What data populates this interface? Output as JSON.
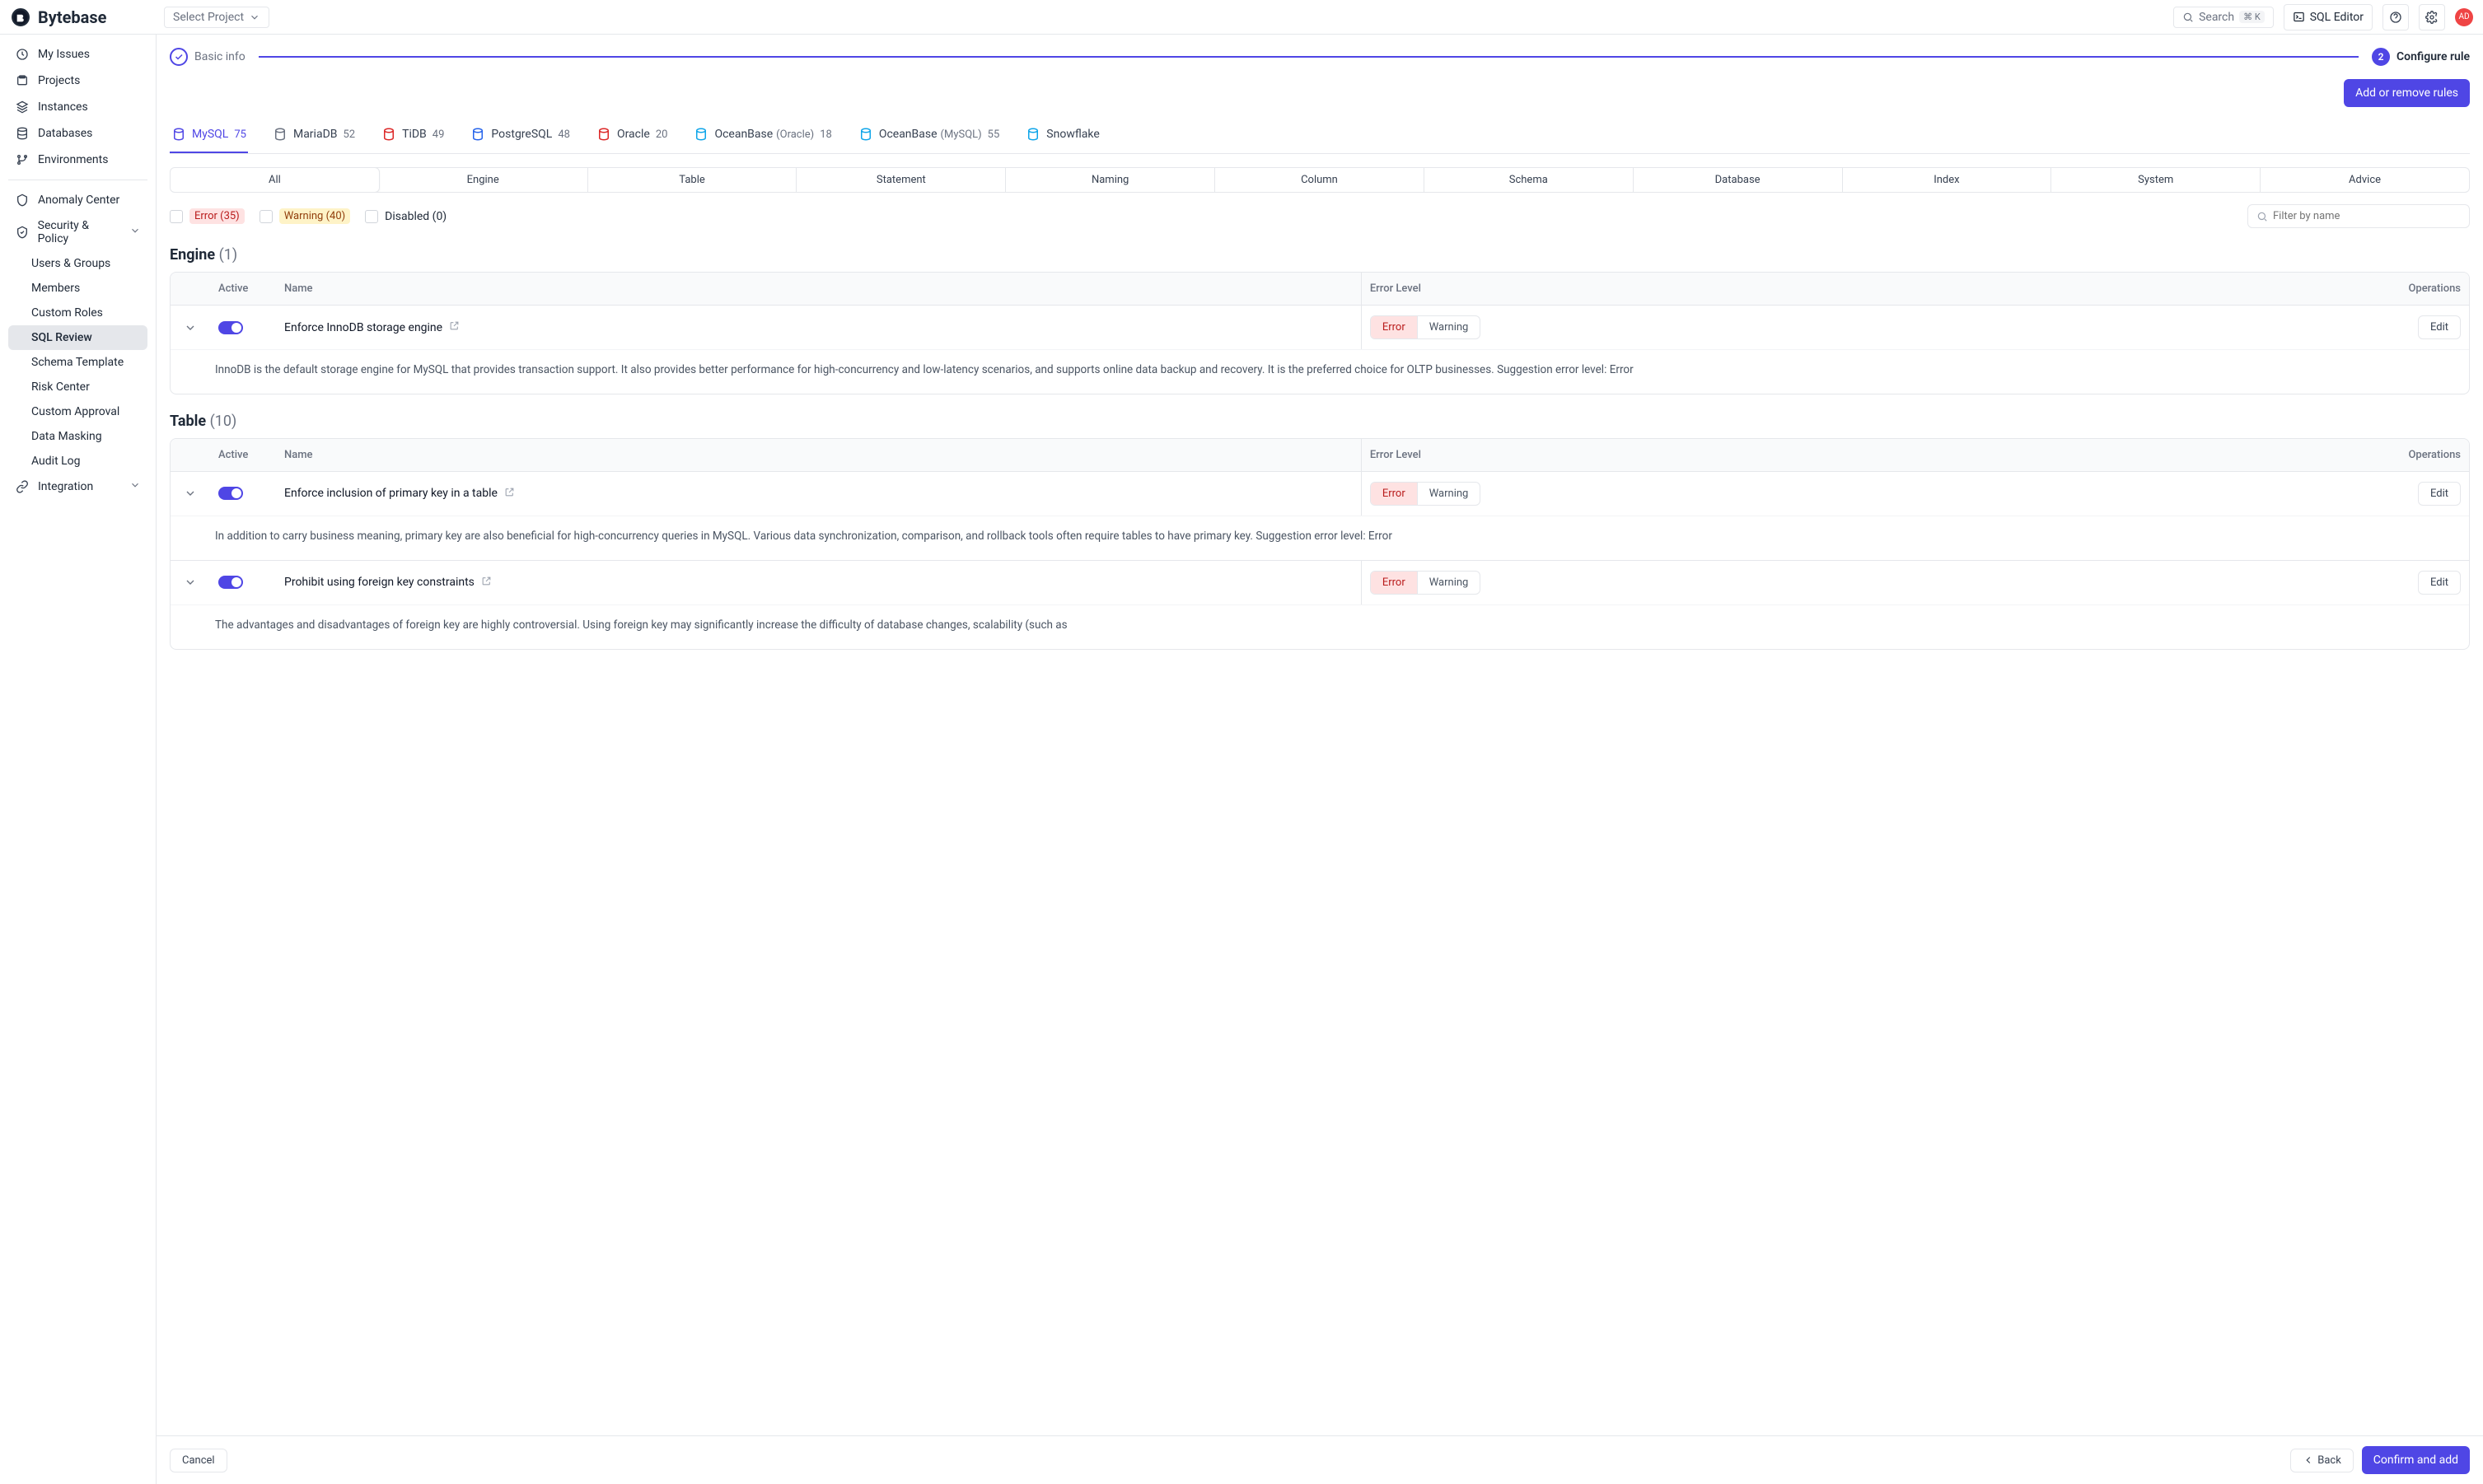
{
  "brand": "Bytebase",
  "header": {
    "select_project": "Select Project",
    "search_placeholder": "Search",
    "search_kbd": "⌘ K",
    "sql_editor": "SQL Editor",
    "avatar": "AD"
  },
  "sidebar": {
    "items": [
      {
        "label": "My Issues",
        "icon": "inbox",
        "sub": false
      },
      {
        "label": "Projects",
        "icon": "folder",
        "sub": false
      },
      {
        "label": "Instances",
        "icon": "stack",
        "sub": false
      },
      {
        "label": "Databases",
        "icon": "database",
        "sub": false
      },
      {
        "label": "Environments",
        "icon": "branch",
        "sub": false
      }
    ],
    "items2": [
      {
        "label": "Anomaly Center",
        "icon": "shield",
        "sub": false,
        "chev": false
      },
      {
        "label": "Security & Policy",
        "icon": "lock",
        "sub": false,
        "chev": true
      },
      {
        "label": "Users & Groups",
        "icon": "",
        "sub": true,
        "chev": false
      },
      {
        "label": "Members",
        "icon": "",
        "sub": true,
        "chev": false
      },
      {
        "label": "Custom Roles",
        "icon": "",
        "sub": true,
        "chev": false
      },
      {
        "label": "SQL Review",
        "icon": "",
        "sub": true,
        "chev": false,
        "active": true
      },
      {
        "label": "Schema Template",
        "icon": "",
        "sub": true,
        "chev": false
      },
      {
        "label": "Risk Center",
        "icon": "",
        "sub": true,
        "chev": false
      },
      {
        "label": "Custom Approval",
        "icon": "",
        "sub": true,
        "chev": false
      },
      {
        "label": "Data Masking",
        "icon": "",
        "sub": true,
        "chev": false
      },
      {
        "label": "Audit Log",
        "icon": "",
        "sub": true,
        "chev": false
      },
      {
        "label": "Integration",
        "icon": "link",
        "sub": false,
        "chev": true
      }
    ]
  },
  "steps": {
    "one_label": "Basic info",
    "two_label": "Configure rule",
    "two_num": "2"
  },
  "actions": {
    "add_remove": "Add or remove rules"
  },
  "db_tabs": [
    {
      "label": "MySQL",
      "count": "75",
      "active": true,
      "color": "#4f46e5"
    },
    {
      "label": "MariaDB",
      "count": "52",
      "color": "#6b7280"
    },
    {
      "label": "TiDB",
      "count": "49",
      "color": "#dc2626"
    },
    {
      "label": "PostgreSQL",
      "count": "48",
      "color": "#2563eb"
    },
    {
      "label": "Oracle",
      "count": "20",
      "color": "#dc2626"
    },
    {
      "label": "OceanBase",
      "sub": "(Oracle)",
      "count": "18",
      "color": "#0ea5e9"
    },
    {
      "label": "OceanBase",
      "sub": "(MySQL)",
      "count": "55",
      "color": "#0ea5e9"
    },
    {
      "label": "Snowflake",
      "count": "",
      "color": "#0ea5e9",
      "cut": true
    }
  ],
  "cat_tabs": [
    "All",
    "Engine",
    "Table",
    "Statement",
    "Naming",
    "Column",
    "Schema",
    "Database",
    "Index",
    "System",
    "Advice"
  ],
  "cat_active": 0,
  "filters": {
    "error": "Error (35)",
    "warning": "Warning (40)",
    "disabled": "Disabled (0)",
    "filter_placeholder": "Filter by name"
  },
  "headers": {
    "active": "Active",
    "name": "Name",
    "error_level": "Error Level",
    "operations": "Operations"
  },
  "levels": {
    "error": "Error",
    "warning": "Warning"
  },
  "edit": "Edit",
  "sections": [
    {
      "title": "Engine",
      "count": "(1)",
      "rules": [
        {
          "name": "Enforce InnoDB storage engine",
          "desc": "InnoDB is the default storage engine for MySQL that provides transaction support. It also provides better performance for high-concurrency and low-latency scenarios, and supports online data backup and recovery. It is the preferred choice for OLTP businesses. Suggestion error level: Error"
        }
      ]
    },
    {
      "title": "Table",
      "count": "(10)",
      "rules": [
        {
          "name": "Enforce inclusion of primary key in a table",
          "desc": "In addition to carry business meaning, primary key are also beneficial for high-concurrency queries in MySQL. Various data synchronization, comparison, and rollback tools often require tables to have primary key. Suggestion error level: Error"
        },
        {
          "name": "Prohibit using foreign key constraints",
          "desc": "The advantages and disadvantages of foreign key are highly controversial. Using foreign key may significantly increase the difficulty of database changes, scalability (such as"
        }
      ]
    }
  ],
  "footer": {
    "cancel": "Cancel",
    "back": "Back",
    "confirm": "Confirm and add"
  }
}
